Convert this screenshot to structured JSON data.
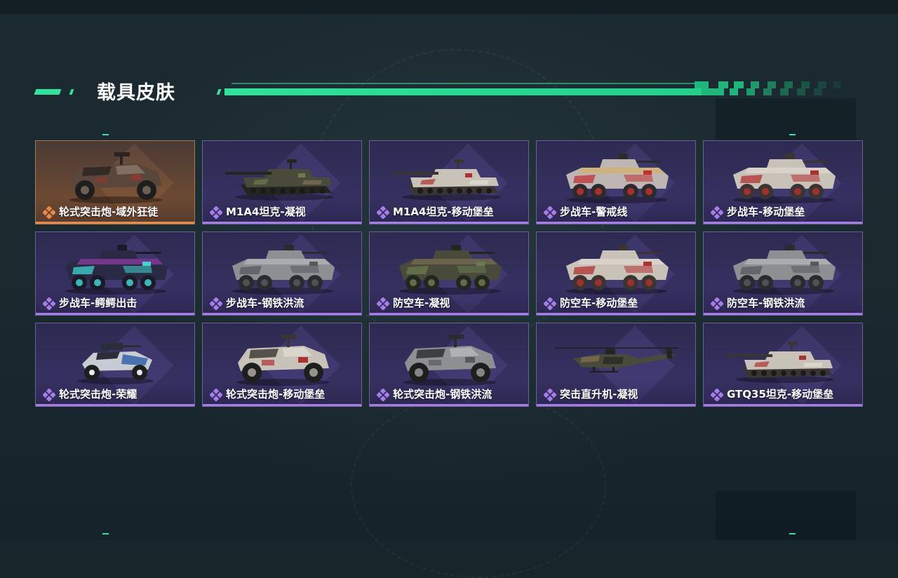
{
  "header": {
    "title": "载具皮肤",
    "accent_color": "#2ee39b"
  },
  "skins": [
    {
      "label": "轮式突击炮-域外狂徒",
      "rarity": "legendary",
      "vehicle": "armored-car",
      "scheme": "rust"
    },
    {
      "label": "M1A4坦克-凝视",
      "rarity": "epic",
      "vehicle": "tank",
      "scheme": "woodland"
    },
    {
      "label": "M1A4坦克-移动堡垒",
      "rarity": "epic",
      "vehicle": "tank",
      "scheme": "fortress"
    },
    {
      "label": "步战车-警戒线",
      "rarity": "epic",
      "vehicle": "ifv",
      "scheme": "caution"
    },
    {
      "label": "步战车-移动堡垒",
      "rarity": "epic",
      "vehicle": "ifv",
      "scheme": "fortress"
    },
    {
      "label": "步战车-鳄鳄出击",
      "rarity": "epic",
      "vehicle": "ifv",
      "scheme": "graffiti"
    },
    {
      "label": "步战车-钢铁洪流",
      "rarity": "epic",
      "vehicle": "ifv",
      "scheme": "steel"
    },
    {
      "label": "防空车-凝视",
      "rarity": "epic",
      "vehicle": "ifv",
      "scheme": "woodland"
    },
    {
      "label": "防空车-移动堡垒",
      "rarity": "epic",
      "vehicle": "ifv",
      "scheme": "fortress"
    },
    {
      "label": "防空车-钢铁洪流",
      "rarity": "epic",
      "vehicle": "ifv",
      "scheme": "steel"
    },
    {
      "label": "轮式突击炮-荣耀",
      "rarity": "epic",
      "vehicle": "buggy",
      "scheme": "glory"
    },
    {
      "label": "轮式突击炮-移动堡垒",
      "rarity": "epic",
      "vehicle": "armored-car",
      "scheme": "fortress"
    },
    {
      "label": "轮式突击炮-钢铁洪流",
      "rarity": "epic",
      "vehicle": "armored-car",
      "scheme": "steel"
    },
    {
      "label": "突击直升机-凝视",
      "rarity": "epic",
      "vehicle": "helicopter",
      "scheme": "woodland"
    },
    {
      "label": "GTQ35坦克-移动堡垒",
      "rarity": "epic",
      "vehicle": "tank",
      "scheme": "fortress"
    }
  ],
  "colors": {
    "epic_accent": "#a67ee9",
    "legendary_accent": "#e8894a",
    "epic_card": "#342f5e",
    "legendary_card": "#6e4a32"
  }
}
